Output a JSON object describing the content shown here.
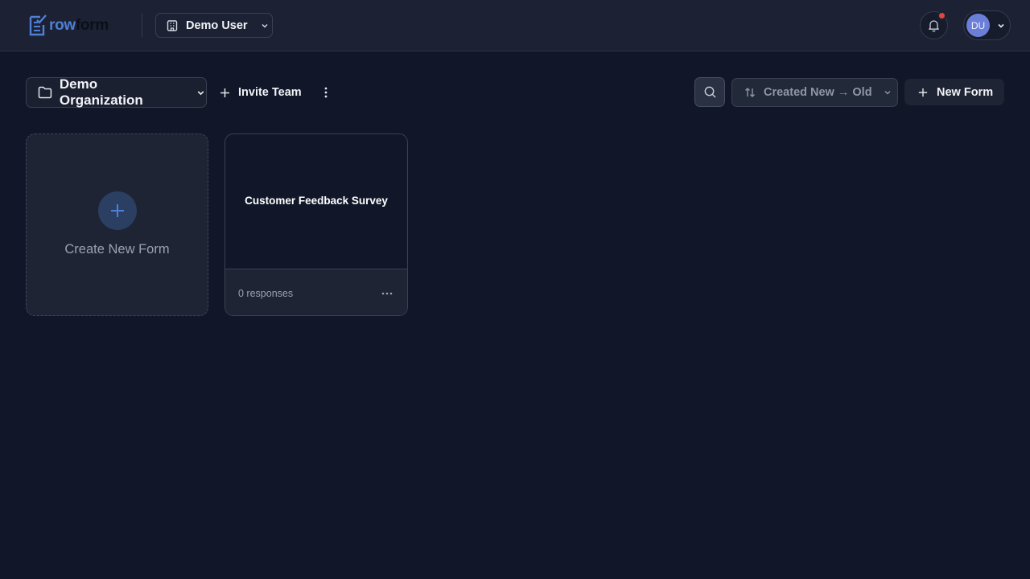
{
  "brand": {
    "logo_part1": "row",
    "logo_part2": "form"
  },
  "header": {
    "workspace_user": "Demo User",
    "avatar_initials": "DU",
    "notification_badge_color": "#e5453a"
  },
  "toolbar": {
    "organization": "Demo Organization",
    "invite_label": "Invite Team",
    "sort_label": "Created New → Old",
    "new_form_label": "New Form"
  },
  "cards": {
    "create_label": "Create New Form",
    "forms": [
      {
        "title": "Customer Feedback Survey",
        "responses": "0 responses"
      }
    ]
  },
  "icons": {
    "logo": "form-checklist-icon",
    "workspace": "building-icon",
    "notifications": "bell-icon",
    "folder": "folder-icon",
    "add": "plus-icon",
    "more": "more-vertical-icon",
    "search": "search-icon",
    "sort": "sort-arrows-icon",
    "card_menu": "more-horizontal-icon"
  },
  "colors": {
    "background": "#111729",
    "topbar": "#1c2233",
    "accent": "#4f7fd6",
    "avatar": "#6b7fd8"
  }
}
